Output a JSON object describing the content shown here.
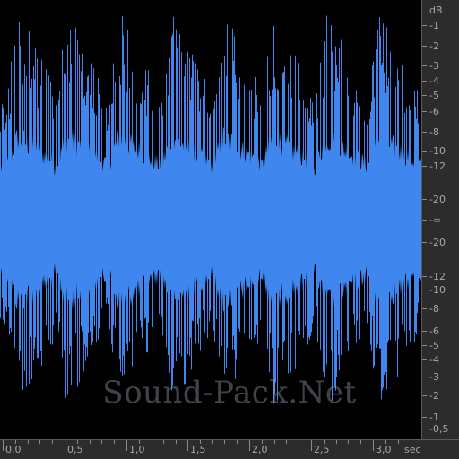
{
  "waveform": {
    "color": "#3f87ef",
    "background": "#000000",
    "duration_seconds": 3.25,
    "bursts_seconds": [
      0.05,
      0.45,
      0.87,
      1.3,
      1.72,
      2.12,
      2.55,
      2.98
    ]
  },
  "db_ruler": {
    "unit": "dB",
    "top_labels": [
      "-1",
      "-2",
      "-3",
      "-4",
      "-5",
      "-6",
      "-8",
      "-10",
      "-12",
      "-20"
    ],
    "center_label": "-∞",
    "bottom_labels": [
      "-20",
      "-12",
      "-10",
      "-8",
      "-6",
      "-5",
      "-4",
      "-3",
      "-2",
      "-1",
      "-0,5"
    ]
  },
  "time_ruler": {
    "unit": "sec",
    "labels": [
      "0,0",
      "0,5",
      "1,0",
      "1,5",
      "2,0",
      "2,5",
      "3,0"
    ]
  },
  "watermark": "Sound-Pack.Net"
}
